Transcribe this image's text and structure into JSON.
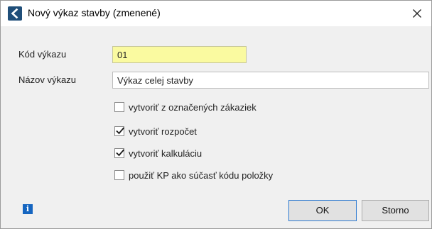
{
  "window": {
    "title": "Nový výkaz stavby (zmenené)",
    "close_label": "×"
  },
  "form": {
    "code": {
      "label": "Kód výkazu",
      "value": "01"
    },
    "name": {
      "label": "Názov výkazu",
      "value": "Výkaz celej stavby"
    }
  },
  "options": [
    {
      "label": "vytvoriť z označených zákaziek",
      "checked": false
    },
    {
      "label": "vytvoriť rozpočet",
      "checked": true
    },
    {
      "label": "vytvoriť kalkuláciu",
      "checked": true
    },
    {
      "label": "použiť KP ako súčasť kódu položky",
      "checked": false
    }
  ],
  "footer": {
    "info_icon": "info-icon",
    "info_glyph": "i",
    "ok_label": "OK",
    "cancel_label": "Storno"
  },
  "colors": {
    "code_field_bg": "#fafaa0",
    "title_icon_bg": "#1f4e79",
    "info_icon_bg": "#1565c0",
    "ok_border": "#2b78d0"
  }
}
